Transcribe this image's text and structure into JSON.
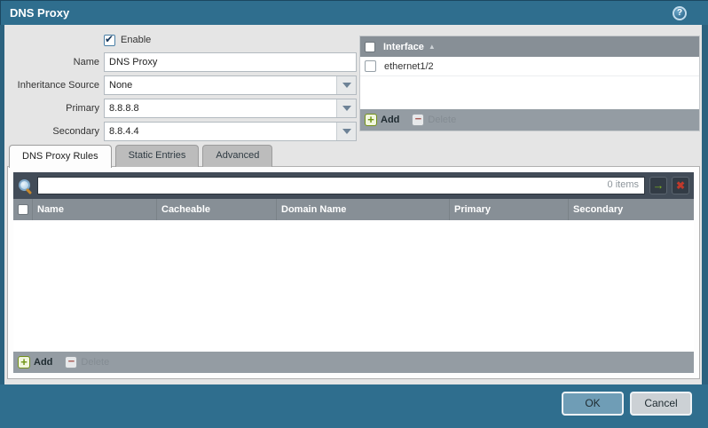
{
  "dialog": {
    "title": "DNS Proxy"
  },
  "form": {
    "enable": {
      "label": "Enable",
      "checked": true
    },
    "fields": [
      {
        "label": "Name",
        "value": "DNS Proxy",
        "type": "text"
      },
      {
        "label": "Inheritance Source",
        "value": "None",
        "type": "dropdown"
      },
      {
        "label": "Primary",
        "value": "8.8.8.8",
        "type": "dropdown"
      },
      {
        "label": "Secondary",
        "value": "8.8.4.4",
        "type": "dropdown"
      }
    ]
  },
  "interface_panel": {
    "header": "Interface",
    "sort": "ascending",
    "rows": [
      {
        "label": "ethernet1/2",
        "checked": false
      }
    ],
    "add_label": "Add",
    "delete_label": "Delete",
    "delete_disabled": true
  },
  "tabs": [
    {
      "label": "DNS Proxy Rules",
      "active": true
    },
    {
      "label": "Static Entries",
      "active": false
    },
    {
      "label": "Advanced",
      "active": false
    }
  ],
  "rules_panel": {
    "search_value": "",
    "items_count": "0 items",
    "columns": [
      "Name",
      "Cacheable",
      "Domain Name",
      "Primary",
      "Secondary"
    ],
    "rows": [],
    "add_label": "Add",
    "delete_label": "Delete",
    "delete_disabled": true
  },
  "footer": {
    "ok_label": "OK",
    "cancel_label": "Cancel"
  },
  "colors": {
    "titlebar": "#2f6e8e",
    "panel_header_gray": "#878f96",
    "searchbar_dark": "#424c58",
    "ok_button": "#6f9db6",
    "cancel_button": "#ccd1d5",
    "add_green": "#6f9413",
    "delete_red": "#aa5a54"
  }
}
